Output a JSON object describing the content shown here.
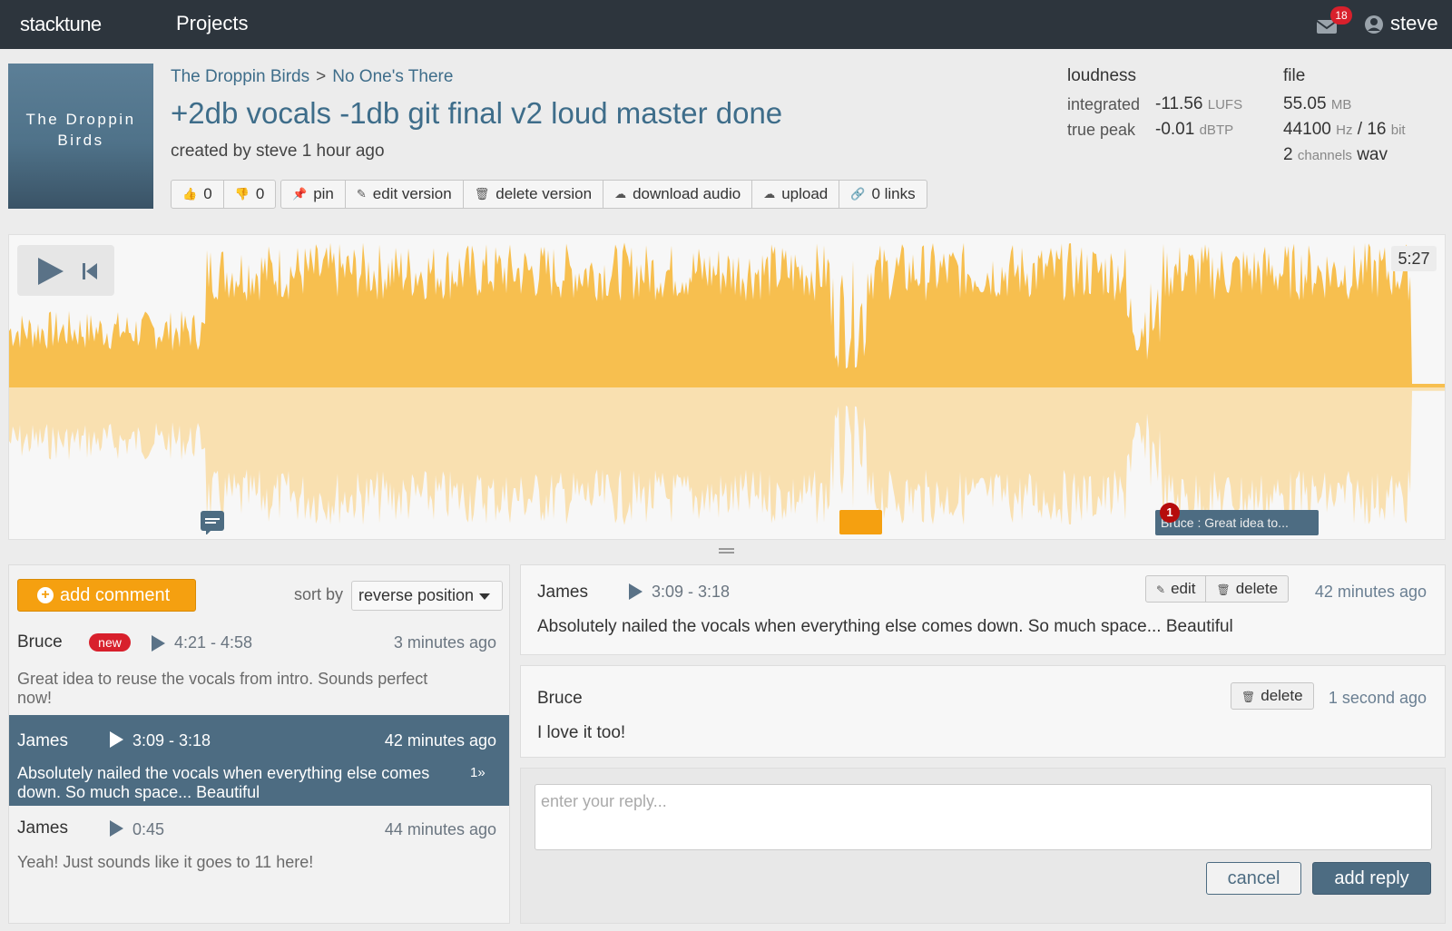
{
  "nav": {
    "logo": "stacktune",
    "projects": "Projects",
    "mail_count": "18",
    "user": "steve"
  },
  "header": {
    "cover_text": "The Droppin Birds",
    "breadcrumb": [
      "The Droppin Birds",
      "No One's There"
    ],
    "breadcrumb_sep": ">",
    "title": "+2db vocals -1db git final v2 loud master done",
    "created": "created by steve 1 hour ago"
  },
  "toolbar": {
    "likes": "0",
    "dislikes": "0",
    "pin": "pin",
    "edit_version": "edit version",
    "delete_version": "delete version",
    "download_audio": "download audio",
    "upload": "upload",
    "links": "0 links"
  },
  "loudness": {
    "heading": "loudness",
    "integrated_label": "integrated",
    "integrated_value": "-11.56",
    "integrated_unit": "LUFS",
    "truepeak_label": "true peak",
    "truepeak_value": "-0.01",
    "truepeak_unit": "dBTP"
  },
  "file": {
    "heading": "file",
    "size_value": "55.05",
    "size_unit": "MB",
    "rate_value": "44100",
    "rate_unit": "Hz",
    "rate_sep": "/",
    "bits_value": "16",
    "bits_unit": "bit",
    "channels_value": "2",
    "channels_unit": "channels",
    "format": "wav"
  },
  "player": {
    "duration": "5:27",
    "marker_label": "Bruce : Great idea to...",
    "marker_count": "1"
  },
  "comments_panel": {
    "add_comment": "add comment",
    "sort_label": "sort by",
    "sort_value": "reverse position",
    "items": [
      {
        "author": "Bruce",
        "badge": "new",
        "range": "4:21 - 4:58",
        "ago": "3 minutes ago",
        "text": "Great idea to reuse the vocals from intro. Sounds perfect now!"
      },
      {
        "author": "James",
        "range": "3:09 - 3:18",
        "ago": "42 minutes ago",
        "text": "Absolutely nailed the vocals when everything else comes down. So much space... Beautiful",
        "replies": "1»"
      },
      {
        "author": "James",
        "range": "0:45",
        "ago": "44 minutes ago",
        "text": "Yeah! Just sounds like it goes to 11 here!"
      }
    ]
  },
  "thread": {
    "main": {
      "author": "James",
      "range": "3:09 - 3:18",
      "edit": "edit",
      "delete": "delete",
      "ago": "42 minutes ago",
      "text": "Absolutely nailed the vocals when everything else comes down. So much space... Beautiful"
    },
    "reply": {
      "author": "Bruce",
      "delete": "delete",
      "ago": "1 second ago",
      "text": "I love it too!"
    },
    "input_placeholder": "enter your reply...",
    "cancel": "cancel",
    "add_reply": "add reply"
  }
}
